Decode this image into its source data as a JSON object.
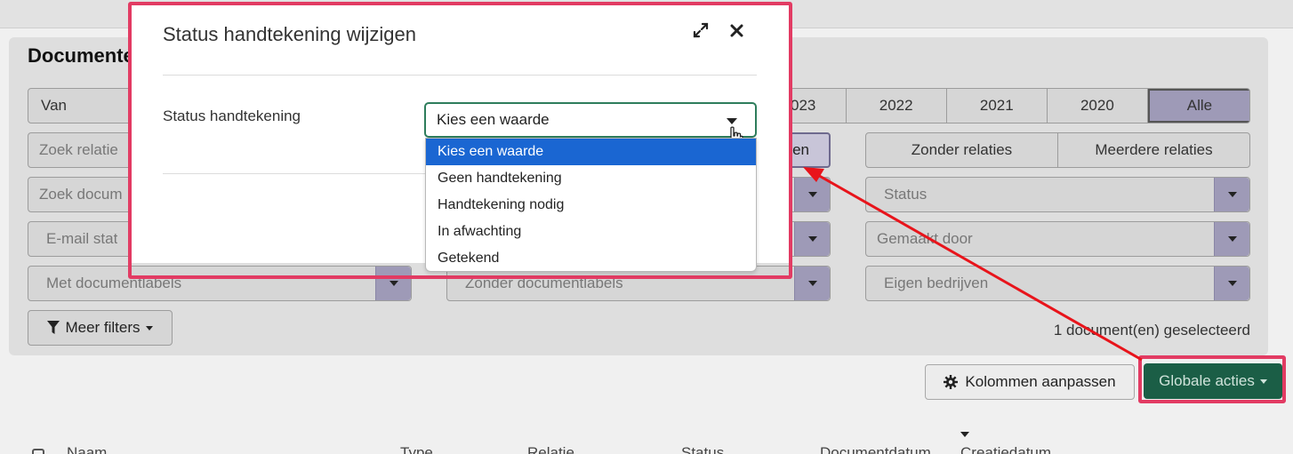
{
  "panel": {
    "title": "Documenten"
  },
  "filters": {
    "van": "Van",
    "years": [
      "023",
      "2022",
      "2021",
      "2020",
      "Alle"
    ],
    "zoek_relatie": "Zoek relatie",
    "relaties_partial": "en",
    "zonder_relaties": "Zonder relaties",
    "meerdere_relaties": "Meerdere relaties",
    "zoek_document": "Zoek docum",
    "status": "Status",
    "email_status": "E-mail stat",
    "gemaakt_door": "Gemaakt door",
    "met_labels": "Met documentlabels",
    "zonder_labels": "Zonder documentlabels",
    "eigen_bedrijven": "Eigen bedrijven",
    "meer_filters": "Meer filters",
    "selected_count": "1 document(en) geselecteerd"
  },
  "actions": {
    "kolommen": "Kolommen aanpassen",
    "globale_acties": "Globale acties"
  },
  "table": {
    "headers": [
      "Naam",
      "Type",
      "Relatie",
      "Status",
      "Documentdatum",
      "Creatiedatum"
    ]
  },
  "modal": {
    "title": "Status handtekening wijzigen",
    "field_label": "Status handtekening",
    "select_value": "Kies een waarde",
    "options": [
      "Kies een waarde",
      "Geen handtekening",
      "Handtekening nodig",
      "In afwachting",
      "Getekend"
    ]
  },
  "colors": {
    "highlight": "#e23b63",
    "arrow": "#e8141b",
    "primary_green": "#1b5e46",
    "option_selected": "#1a66d2"
  }
}
